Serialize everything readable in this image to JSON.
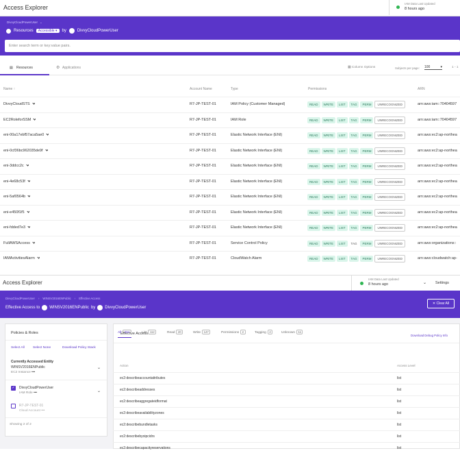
{
  "top": {
    "title": "Access Explorer",
    "updated_label": "IAM Data Last Updated",
    "updated_value": "8 hours ago",
    "breadcrumb": "DivvyCloudPowerUser",
    "filter_resources": "Resources",
    "filter_accessible": "Accessible",
    "filter_by": "by",
    "filter_user": "DivvyCloudPowerUser",
    "search_placeholder": "Enter search term or key:value pairs.",
    "tabs": [
      "Resources",
      "Applications"
    ],
    "column_options": "Column Options",
    "subjects_per_page_label": "Subjects per page:",
    "per_page": "100",
    "range": "1 - 1",
    "columns": [
      "Name",
      "Account Name",
      "Type",
      "Permissions",
      "ARN"
    ],
    "permissions": [
      "READ",
      "WRITE",
      "LIST",
      "TAG",
      "PERM",
      "UNRECOGNIZED"
    ],
    "rows": [
      {
        "name": "DivvyCloudSTS",
        "account": "R7-JP-TEST-01",
        "type": "IAM Policy (Customer Managed)",
        "arn": "arn:aws:iam::70404597",
        "tag_active": true
      },
      {
        "name": "EC2RoleforSSM",
        "account": "R7-JP-TEST-01",
        "type": "IAM Role",
        "arn": "arn:aws:iam::70404597",
        "tag_active": true
      },
      {
        "name": "eni-00a17ebf57aca5ae0",
        "account": "R7-JP-TEST-01",
        "type": "Elastic Network Interface (ENI)",
        "arn": "arn:aws:ec2:ap-northea",
        "tag_active": true
      },
      {
        "name": "eni-0cf36bc962035de9f",
        "account": "R7-JP-TEST-01",
        "type": "Elastic Network Interface (ENI)",
        "arn": "arn:aws:ec2:ap-northea",
        "tag_active": true
      },
      {
        "name": "eni-3ddcc2c",
        "account": "R7-JP-TEST-01",
        "type": "Elastic Network Interface (ENI)",
        "arn": "arn:aws:ec2:ap-northea",
        "tag_active": true
      },
      {
        "name": "eni-4e68c53f",
        "account": "R7-JP-TEST-01",
        "type": "Elastic Network Interface (ENI)",
        "arn": "arn:aws:ec2:ap-northea",
        "tag_active": true
      },
      {
        "name": "eni-5af0564b",
        "account": "R7-JP-TEST-01",
        "type": "Elastic Network Interface (ENI)",
        "arn": "arn:aws:ec2:ap-northea",
        "tag_active": true
      },
      {
        "name": "eni-e450f1f5",
        "account": "R7-JP-TEST-01",
        "type": "Elastic Network Interface (ENI)",
        "arn": "arn:aws:ec2:ap-northea",
        "tag_active": true
      },
      {
        "name": "eni-fdded7e3",
        "account": "R7-JP-TEST-01",
        "type": "Elastic Network Interface (ENI)",
        "arn": "arn:aws:ec2:ap-northea",
        "tag_active": true
      },
      {
        "name": "FullAWSAccess",
        "account": "R7-JP-TEST-01",
        "type": "Service Control Policy",
        "arn": "arn:aws:organizations::",
        "tag_active": false
      },
      {
        "name": "IAMActivitiesAlarm",
        "account": "R7-JP-TEST-01",
        "type": "CloudWatch Alarm",
        "arn": "arn:aws:cloudwatch:ap-",
        "tag_active": true
      }
    ]
  },
  "bottom": {
    "title": "Access Explorer",
    "updated_label": "IAM Data Last Updated",
    "updated_value": "8 hours ago",
    "settings": "Settings",
    "breadcrumb": [
      "DivvyCloudPowerUser",
      "WINSV2016ENPublic",
      "Effective Access"
    ],
    "effective_prefix": "Effective Access to",
    "effective_target": "WINSV2016ENPublic",
    "effective_by": "by",
    "effective_user": "DivvyCloudPowerUser",
    "clear_all": "Clear All",
    "policies_title": "Policies & Roles",
    "select_all": "Select All",
    "select_none": "Select None",
    "download_stack": "Download Policy Stack",
    "current_label": "Currently Accessed Entity",
    "current_name": "WINSV2016ENPublic",
    "current_type": "EC2 Instance",
    "entities": [
      {
        "name": "DivvyCloudPowerUser",
        "type": "IAM Role",
        "checked": true
      },
      {
        "name": "R7-JP-TEST-01",
        "type": "Cloud Account",
        "checked": false
      }
    ],
    "showing": "Showing 2 of 2",
    "effective_title": "Effective Access",
    "download_debug": "Download Debug Policy Info",
    "tabs": [
      {
        "label": "All",
        "count": "294"
      },
      {
        "label": "List",
        "count": "112"
      },
      {
        "label": "Read",
        "count": "20"
      },
      {
        "label": "Write",
        "count": "147"
      },
      {
        "label": "Permissions",
        "count": "2"
      },
      {
        "label": "Tagging",
        "count": "2"
      },
      {
        "label": "Unknown",
        "count": "11"
      }
    ],
    "col_action": "Action",
    "col_level": "Access Level",
    "actions": [
      {
        "action": "ec2:describeaccountattributes",
        "level": "list"
      },
      {
        "action": "ec2:describeaddresses",
        "level": "list"
      },
      {
        "action": "ec2:describeaggregateidformat",
        "level": "list"
      },
      {
        "action": "ec2:describeavailabilityzones",
        "level": "list"
      },
      {
        "action": "ec2:describebundletasks",
        "level": "list"
      },
      {
        "action": "ec2:describebyoipcidrs",
        "level": "list"
      },
      {
        "action": "ec2:describecapacityreservations",
        "level": "list"
      }
    ]
  }
}
